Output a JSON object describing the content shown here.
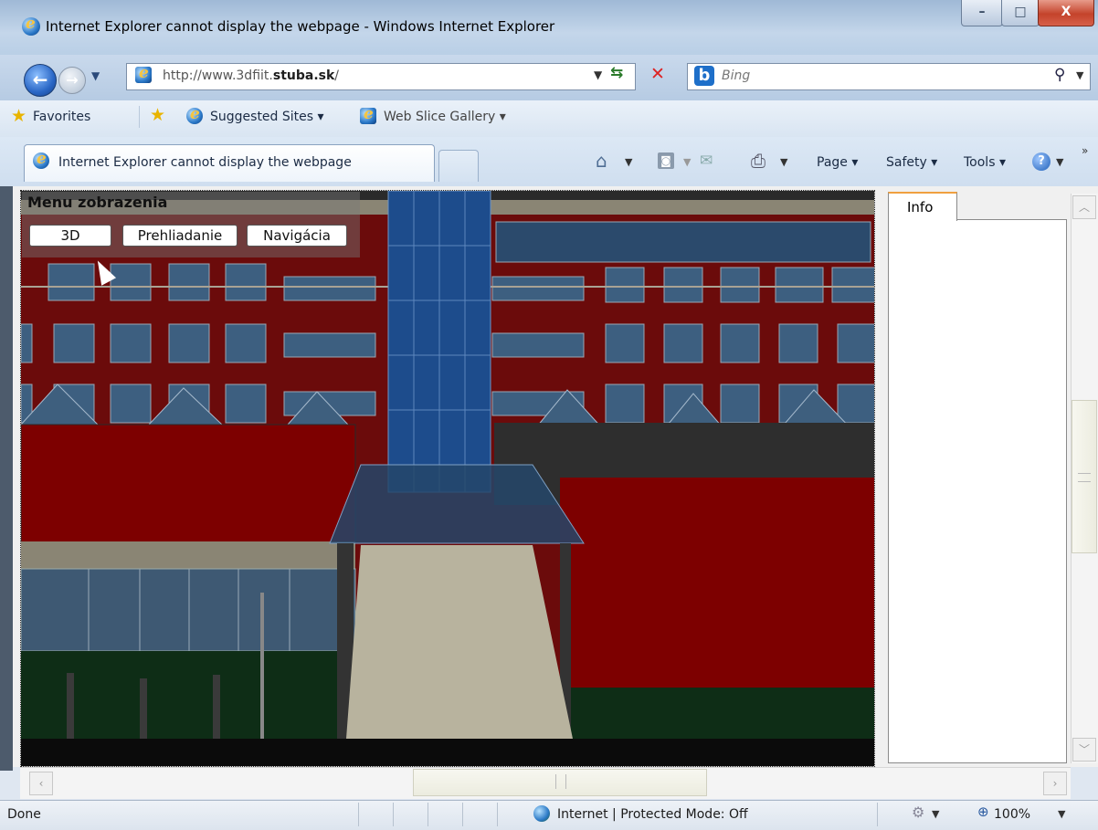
{
  "window": {
    "title": "Internet Explorer cannot display the webpage - Windows Internet Explorer",
    "minimize": "–",
    "maximize": "□",
    "close": "X"
  },
  "address_bar": {
    "url_prefix": "http://www.3dfiit.",
    "url_domain": "stuba.sk",
    "url_suffix": "/",
    "search_placeholder": "Bing"
  },
  "favorites_bar": {
    "favorites": "Favorites",
    "suggested_sites": "Suggested Sites ▾",
    "web_slice_gallery": "Web Slice Gallery ▾"
  },
  "tabs": {
    "active_label": "Internet Explorer cannot display the webpage"
  },
  "command_bar": {
    "page": "Page ▾",
    "safety": "Safety ▾",
    "tools": "Tools ▾"
  },
  "page": {
    "menu_title": "Menu zobrazenia",
    "menu_buttons": [
      "3D",
      "Prehliadanie",
      "Navigácia"
    ],
    "info_tab": "Info"
  },
  "status_bar": {
    "status": "Done",
    "zone": "Internet | Protected Mode: Off",
    "zoom": "100%"
  }
}
